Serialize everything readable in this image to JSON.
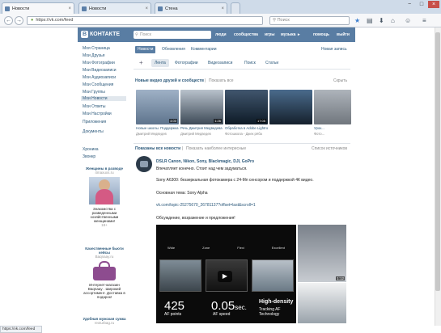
{
  "browser": {
    "tabs": [
      {
        "label": "Новости",
        "close": "×"
      },
      {
        "label": "Новости",
        "close": "×"
      },
      {
        "label": "Стена",
        "close": "×"
      }
    ],
    "window_buttons": [
      "−",
      "□",
      "×"
    ],
    "back": "←",
    "forward": "→",
    "url": "https://vk.com/feed",
    "reload": "↻",
    "search_placeholder": "Поиск",
    "toolbar_icons": [
      "★",
      "▤",
      "⬇",
      "⌂",
      "☺",
      "≡"
    ]
  },
  "vk": {
    "logo_letter": "В",
    "logo_text": "КОНТАКТЕ",
    "search_placeholder": "Поиск",
    "nav": [
      "люди",
      "сообщества",
      "игры",
      "музыка",
      "помощь",
      "выйти"
    ],
    "music_arrow": "▸"
  },
  "left_menu": [
    "Моя Страница",
    "Мои Друзья",
    "Мои Фотографии",
    "Мои Видеозаписи",
    "Мои Аудиозаписи",
    "Мои Сообщения",
    "Мои Группы",
    "Мои Новости",
    "Мои Ответы",
    "Мои Настройки",
    "Приложения",
    "Документы",
    "Хроника",
    "Звонкр"
  ],
  "ads": [
    {
      "title": "Женщины в разводе",
      "source": "4maxuxs.ru",
      "text": "Знакомства с разведенными хозяйственными женщинами!",
      "age": "18+"
    },
    {
      "title": "Качественные бьюти кейсы",
      "source": "Baqnaay.ru",
      "text": "Интернет-магазин Baqnaay . Широкий ассортимент. Доставка в подарок!"
    },
    {
      "title": "Удобная мужская сумка",
      "source": "rexturbag.ru"
    }
  ],
  "content": {
    "tabs": [
      "Новости",
      "Обновления",
      "Комментарии"
    ],
    "new_post": "Новая запись",
    "filters": [
      "Лента",
      "Фотографии",
      "Видеозаписи",
      "Поиск",
      "Статьи"
    ],
    "add_icon": "+",
    "videos_header": "Новые видео друзей и сообществ",
    "show_all": "Показать все",
    "hide": "Скрыть",
    "videos": [
      {
        "title": "Новые школы. Поддержка АПК...",
        "author": "Дмитрий Медведев",
        "duration": "4:00",
        "color": "#6f8aa8"
      },
      {
        "title": "Речь Дмитрия Медведева в Мон...",
        "author": "Дмитрий Медведев",
        "duration": "1:26",
        "color": "#4f5d6a"
      },
      {
        "title": "Обработка в Adobe Lightroom: по...",
        "author": "Фотошкола - Джек рёба",
        "duration": "17:05",
        "color": "#1d2b3a"
      },
      {
        "title": "Урок...",
        "author": "Фото...",
        "duration": "",
        "color": "#8a9099"
      }
    ],
    "news_header": "Показаны все новости",
    "news_link": "Показать наиболее интересные",
    "sources": "Список источников",
    "post": {
      "author": "DSLR Canon, Nikon, Sony, Blackmagic, DJI, GoPro",
      "lead": "Впечатляет конечно. Стоит над чем задуматься.",
      "line1": "Sony A6300: беззеркальная фотокамера с 24-Мп сенсором и поддержкой 4К видео.",
      "line2": "Основная тема: Sony Alpha",
      "line3": "vk.com/topic-25275670_26781137?offset=last&scroll=1",
      "line4": "Обсуждение, возражение и предложения!",
      "stats": [
        {
          "value": "425",
          "label": "AF points"
        },
        {
          "value": "0.05",
          "unit": "sec.",
          "label": "AF speed"
        },
        {
          "value": "High-density",
          "label": "Tracking AF Technology"
        }
      ],
      "mini_labels": [
        "Wide",
        "Zone",
        "Flexi",
        "Excellent"
      ],
      "thumb_duration": "1:12"
    }
  },
  "statusbar": "https://vk.com/feed"
}
